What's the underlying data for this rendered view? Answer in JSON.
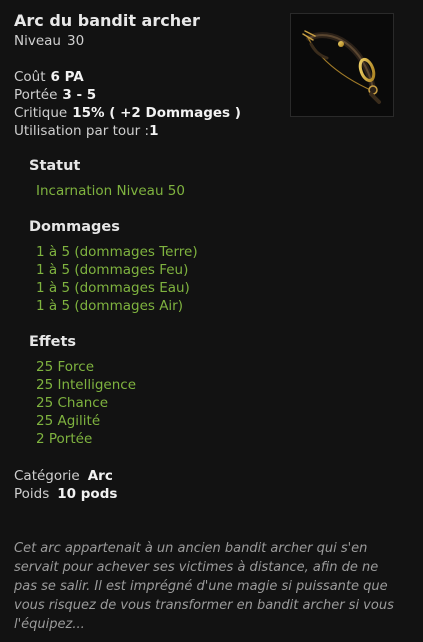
{
  "item": {
    "name": "Arc du bandit archer",
    "level_label": "Niveau",
    "level_value": "30",
    "image_icon": "bow-icon"
  },
  "stats": {
    "cost_label": "Coût",
    "cost_value": "6 PA",
    "range_label": "Portée",
    "range_value": "3 - 5",
    "crit_label": "Critique",
    "crit_value": "15% ( +2 Dommages )",
    "uses_label": "Utilisation par tour :",
    "uses_value": "1"
  },
  "statut": {
    "title": "Statut",
    "lines": [
      "Incarnation Niveau 50"
    ]
  },
  "dommages": {
    "title": "Dommages",
    "lines": [
      "1 à 5 (dommages Terre)",
      "1 à 5 (dommages Feu)",
      "1 à 5 (dommages Eau)",
      "1 à 5 (dommages Air)"
    ]
  },
  "effets": {
    "title": "Effets",
    "lines": [
      "25 Force",
      "25 Intelligence",
      "25 Chance",
      "25 Agilité",
      "2 Portée"
    ]
  },
  "info": {
    "category_label": "Catégorie",
    "category_value": "Arc",
    "weight_label": "Poids",
    "weight_value": "10 pods"
  },
  "description": "Cet arc appartenait à un ancien bandit archer qui s'en servait pour achever ses victimes à distance, afin de ne pas se salir. Il est imprégné d'une magie si puissante que vous risquez de vous transformer en bandit archer si vous l'équipez...",
  "colors": {
    "background": "#121212",
    "effect_green": "#7fb33f",
    "description_grey": "#9b9b9b"
  }
}
